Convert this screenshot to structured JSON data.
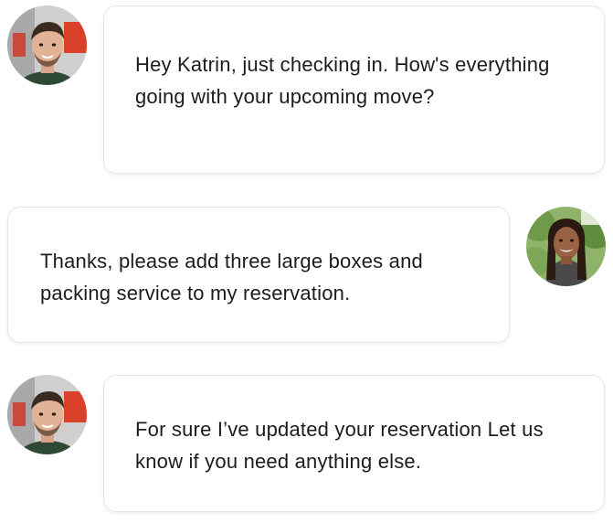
{
  "conversation": {
    "messages": [
      {
        "sender": "agent",
        "avatar_icon": "agent-avatar-icon",
        "text": "Hey Katrin, just checking in. How's everything going with your upcoming move?"
      },
      {
        "sender": "customer",
        "avatar_icon": "customer-avatar-icon",
        "text": "Thanks, please add three large boxes and packing service to my reservation."
      },
      {
        "sender": "agent",
        "avatar_icon": "agent-avatar-icon",
        "text": "For sure I’ve updated your reservation Let us know if you need anything else."
      }
    ]
  },
  "colors": {
    "bubble_background": "#ffffff",
    "bubble_border": "#e6e6e6",
    "text": "#1c1c1c",
    "agent_shirt": "#2f4a34",
    "agent_background_accent": "#d9412b",
    "customer_background": "#6f9a4a"
  }
}
